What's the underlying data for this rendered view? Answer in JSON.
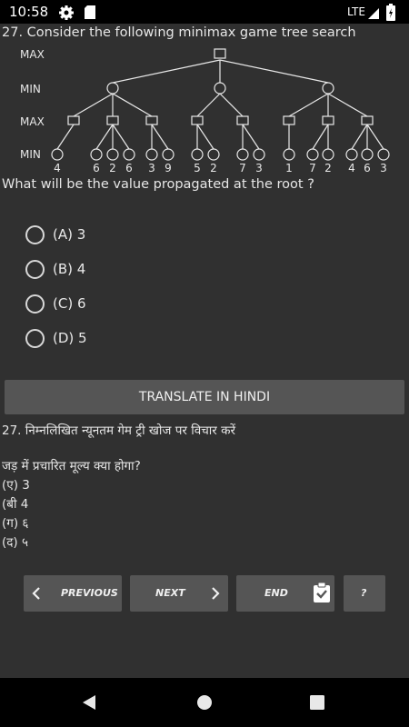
{
  "status_bar": {
    "time": "10:58",
    "network": "LTE",
    "icons": [
      "gear-icon",
      "sd-card-icon",
      "signal-icon",
      "battery-icon"
    ]
  },
  "question": {
    "text": "27. Consider the following minimax game tree search",
    "tree_level_labels": [
      "MAX",
      "MIN",
      "MAX",
      "MIN"
    ],
    "leaf_values": [
      "4",
      "6",
      "2",
      "6",
      "3",
      "9",
      "5",
      "2",
      "7",
      "3",
      "1",
      "7",
      "2",
      "4",
      "6",
      "3"
    ],
    "root_question": "What will be the value propagated at the root ?"
  },
  "options": [
    {
      "label": "(A) 3"
    },
    {
      "label": "(B) 4"
    },
    {
      "label": "(C) 6"
    },
    {
      "label": "(D) 5"
    }
  ],
  "translate_button": "TRANSLATE IN HINDI",
  "hindi": {
    "question": "27. निम्नलिखित न्यूनतम गेम ट्री खोज पर विचार करें",
    "root_question": "जड़ में प्रचारित मूल्य क्या होगा?",
    "options": [
      "(ए) 3",
      "(बी 4",
      "(ग) ६",
      "(द) ५"
    ]
  },
  "nav_buttons": {
    "previous": "PREVIOUS",
    "next": "NEXT",
    "end": "END",
    "help": "?"
  },
  "colors": {
    "background": "#303030",
    "button": "#555555",
    "bar": "#000000"
  }
}
